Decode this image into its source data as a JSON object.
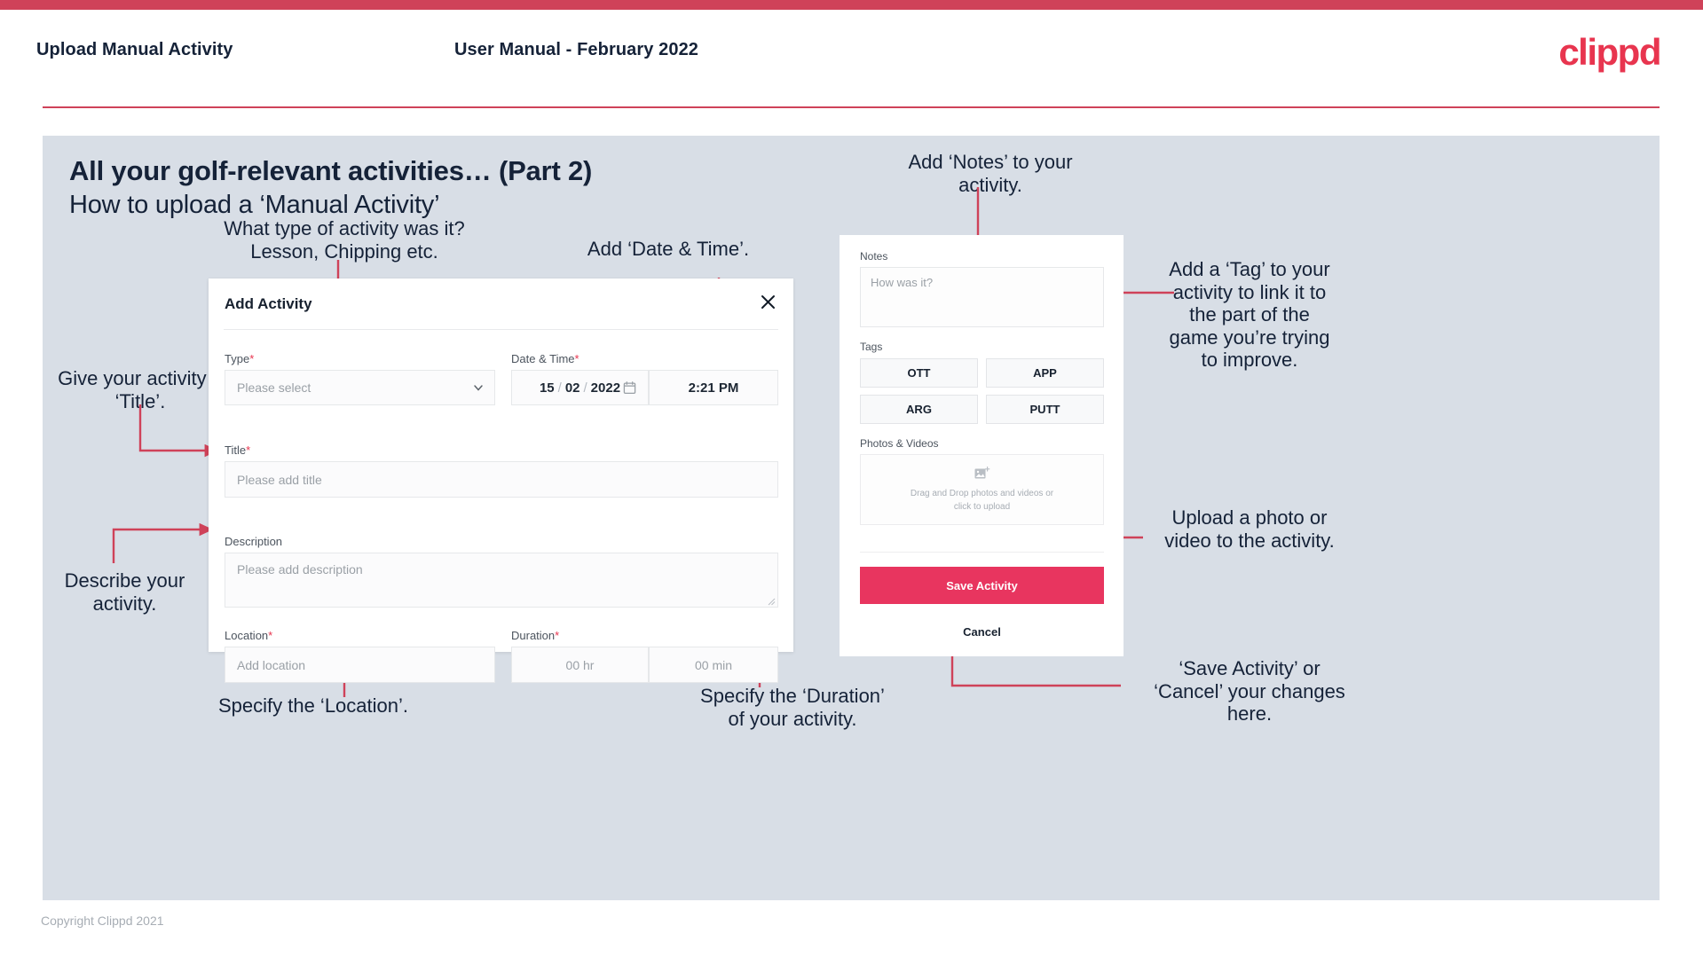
{
  "header": {
    "left_title": "Upload Manual Activity",
    "center_title": "User Manual - February 2022",
    "logo": "clippd"
  },
  "slide": {
    "title_main": "All your golf-relevant activities… (Part 2)",
    "title_sub": "How to upload a ‘Manual Activity’"
  },
  "annotations": {
    "type": "What type of activity was it?\nLesson, Chipping etc.",
    "datetime": "Add ‘Date & Time’.",
    "title": "Give your activity a\n‘Title’.",
    "description": "Describe your\nactivity.",
    "location": "Specify the ‘Location’.",
    "duration": "Specify the ‘Duration’\nof your activity.",
    "notes": "Add ‘Notes’ to your\nactivity.",
    "tags": "Add a ‘Tag’ to your\nactivity to link it to\nthe part of the\ngame you’re trying\nto improve.",
    "upload": "Upload a photo or\nvideo to the activity.",
    "save_cancel": "‘Save Activity’ or\n‘Cancel’ your changes\nhere."
  },
  "dialog": {
    "title": "Add Activity",
    "close_icon": "close-icon",
    "fields": {
      "type": {
        "label": "Type",
        "required": "*",
        "placeholder": "Please select"
      },
      "datetime": {
        "label": "Date & Time",
        "required": "*",
        "day": "15",
        "month": "02",
        "year": "2022",
        "sep": "/",
        "time": "2:21 PM"
      },
      "title": {
        "label": "Title",
        "required": "*",
        "placeholder": "Please add title"
      },
      "description": {
        "label": "Description",
        "placeholder": "Please add description"
      },
      "location": {
        "label": "Location",
        "required": "*",
        "placeholder": "Add location"
      },
      "duration": {
        "label": "Duration",
        "required": "*",
        "hours": "00 hr",
        "minutes": "00 min"
      }
    }
  },
  "phone": {
    "notes_label": "Notes",
    "notes_placeholder": "How was it?",
    "tags_label": "Tags",
    "tags": [
      "OTT",
      "APP",
      "ARG",
      "PUTT"
    ],
    "photos_label": "Photos & Videos",
    "dropzone_text": "Drag and Drop photos and videos or\nclick to upload",
    "dropzone_icon": "add-image-icon",
    "save_label": "Save Activity",
    "cancel_label": "Cancel"
  },
  "footer": {
    "copyright": "Copyright Clippd 2021"
  },
  "colors": {
    "brand_pink": "#e8354f",
    "accent_crimson": "#cf4259",
    "slide_bg": "#d8dee6",
    "text_dark": "#152238",
    "save_button": "#e8355f"
  }
}
